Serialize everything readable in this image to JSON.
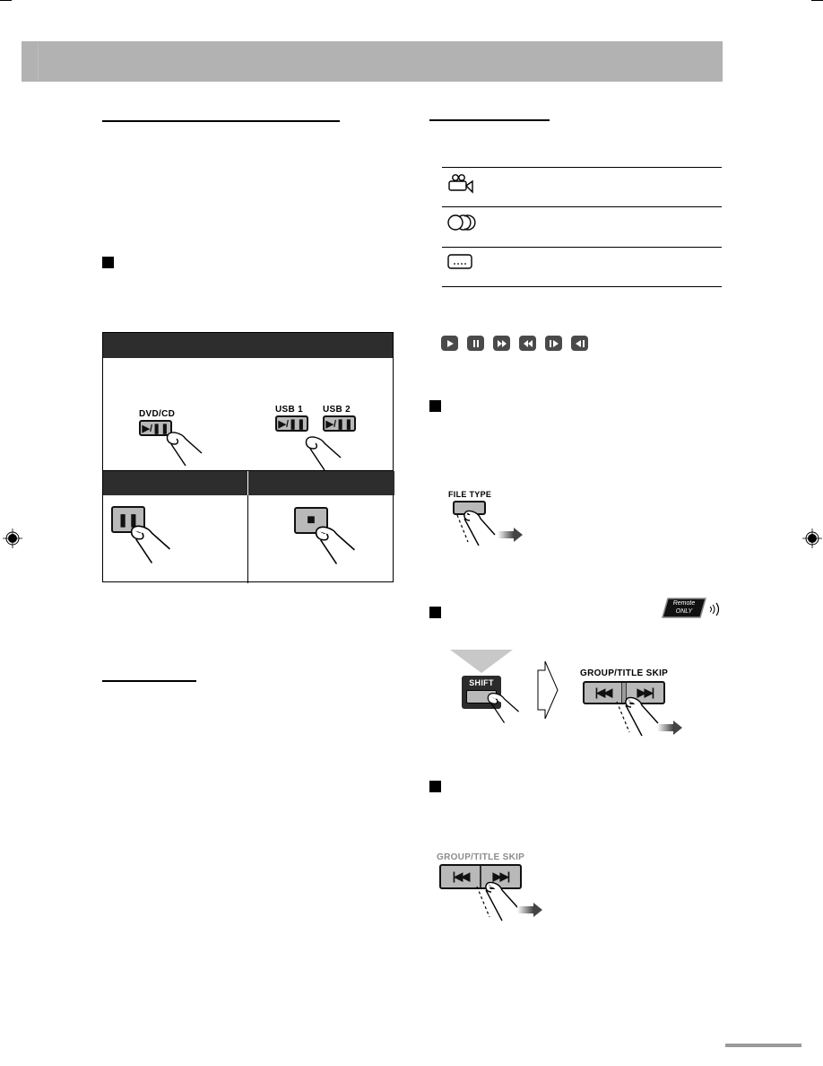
{
  "page": {
    "header_bar": {
      "title": "",
      "color": "#b2b2b2"
    },
    "footer_bar": {
      "color": "#9a9a9a"
    }
  },
  "left_column": {
    "section1": {
      "heading": ""
    },
    "subsection1": {
      "bullet": "square",
      "heading": ""
    },
    "operation_table": {
      "header": "",
      "start_cell": {
        "buttons": [
          {
            "label": "DVD/CD",
            "key": "▶/❚❚",
            "icon": "play-pause-icon"
          },
          {
            "label": "USB 1",
            "key": "▶/❚❚",
            "icon": "play-pause-icon"
          },
          {
            "label": "USB 2",
            "key": "▶/❚❚",
            "icon": "play-pause-icon"
          }
        ]
      },
      "columns": [
        {
          "header": "",
          "key_icon": "pause-icon",
          "key": "❚❚"
        },
        {
          "header": "",
          "key_icon": "stop-icon",
          "key": "■"
        }
      ]
    },
    "section2": {
      "heading": ""
    }
  },
  "right_column": {
    "section1": {
      "heading": ""
    },
    "icon_table": {
      "rows": [
        {
          "icon": "movie-camera-icon",
          "text": ""
        },
        {
          "icon": "audio-discs-icon",
          "text": ""
        },
        {
          "icon": "still-picture-icon",
          "text": ""
        }
      ]
    },
    "playback_icons": [
      {
        "name": "play-icon",
        "glyph": "▶"
      },
      {
        "name": "pause-icon",
        "glyph": "❚❚"
      },
      {
        "name": "fast-forward-icon",
        "glyph": "▶▶"
      },
      {
        "name": "fast-reverse-icon",
        "glyph": "◀◀"
      },
      {
        "name": "slow-forward-icon",
        "glyph": "❚▶"
      },
      {
        "name": "slow-reverse-icon",
        "glyph": "◀❚"
      }
    ],
    "subsection_file_type": {
      "bullet": "square",
      "heading": "",
      "button_label": "FILE TYPE"
    },
    "subsection_group_skip_remote": {
      "bullet": "square",
      "heading": "",
      "badge": {
        "line1": "Remote",
        "line2": "ONLY"
      },
      "shift_label": "SHIFT",
      "skip_label": "GROUP/TITLE SKIP",
      "skip_prev": "|◀◀",
      "skip_next": "▶▶|"
    },
    "subsection_group_skip_unit": {
      "bullet": "square",
      "heading": "",
      "skip_label": "GROUP/TITLE SKIP",
      "skip_prev": "|◀◀",
      "skip_next": "▶▶|"
    }
  }
}
